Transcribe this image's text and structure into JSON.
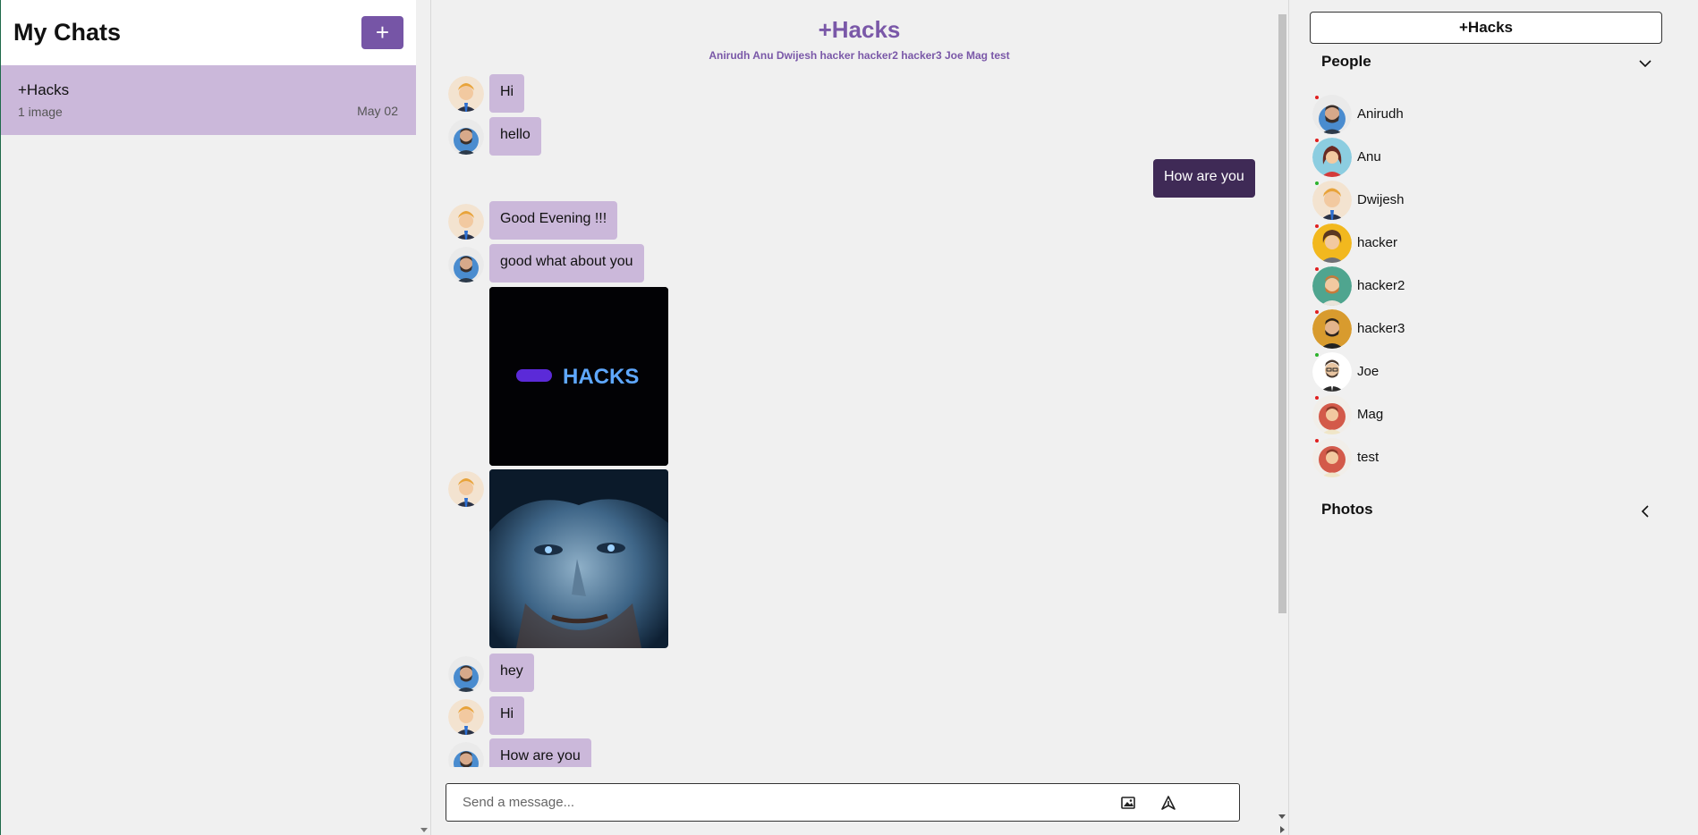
{
  "sidebar": {
    "title": "My Chats",
    "new_chat_label": "+",
    "chats": [
      {
        "name": "+Hacks",
        "preview": "1 image",
        "date": "May 02"
      }
    ]
  },
  "chat": {
    "title": "+Hacks",
    "members": "Anirudh Anu Dwijesh hacker hacker2 hacker3 Joe Mag test",
    "messages": [
      {
        "text": "Hi"
      },
      {
        "text": "hello"
      },
      {
        "text": "How are you"
      },
      {
        "text": "Good Evening !!!"
      },
      {
        "text": "good what about you"
      },
      {
        "text": "hey"
      },
      {
        "text": "Hi"
      },
      {
        "text": "How are you"
      }
    ],
    "image_logo_text": "HACKS",
    "composer_placeholder": "Send a message..."
  },
  "details": {
    "group_name": "+Hacks",
    "people_label": "People",
    "photos_label": "Photos",
    "people": [
      {
        "name": "Anirudh",
        "status_color": "#e02020"
      },
      {
        "name": "Anu",
        "status_color": "#e02020"
      },
      {
        "name": "Dwijesh",
        "status_color": "#2db32d"
      },
      {
        "name": "hacker",
        "status_color": "#e02020"
      },
      {
        "name": "hacker2",
        "status_color": "#e02020"
      },
      {
        "name": "hacker3",
        "status_color": "#e02020"
      },
      {
        "name": "Joe",
        "status_color": "#2db32d"
      },
      {
        "name": "Mag",
        "status_color": "#e02020"
      },
      {
        "name": "test",
        "status_color": "#e02020"
      }
    ]
  },
  "colors": {
    "accent": "#7a58a8",
    "bubble": "#cbb8da",
    "bubble_me": "#3f2a56"
  }
}
